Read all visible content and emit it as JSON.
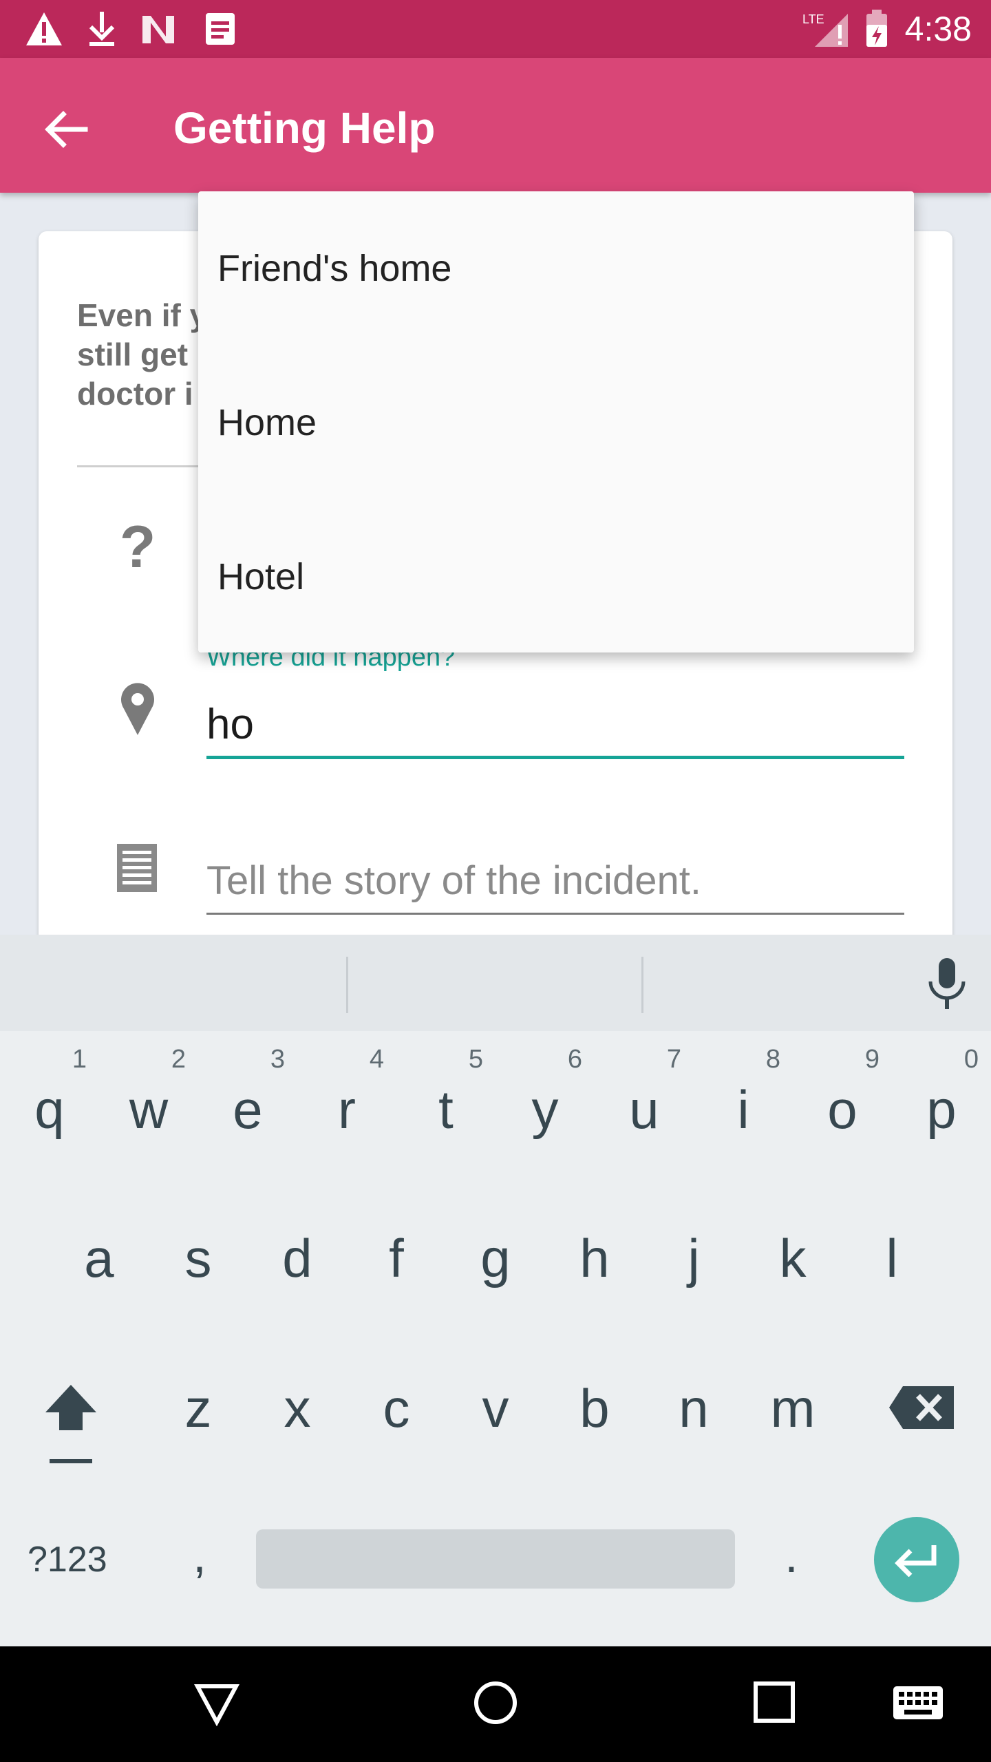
{
  "status_bar": {
    "time": "4:38",
    "network_label": "LTE",
    "left_icons": [
      "warning-icon",
      "download-icon",
      "n-logo-icon",
      "notes-icon"
    ],
    "right_icons": [
      "signal-icon",
      "battery-icon"
    ]
  },
  "app_bar": {
    "title": "Getting Help",
    "back_icon": "arrow-back-icon"
  },
  "card": {
    "intro_text": "Even if y\nstill get\ndoctor i",
    "question_icon": "?",
    "location_field": {
      "label": "Where did it happen?",
      "value": "ho"
    },
    "story_field": {
      "placeholder": "Tell the story of the incident."
    }
  },
  "dropdown": {
    "items": [
      "Friend's home",
      "Home",
      "Hotel"
    ]
  },
  "keyboard": {
    "row1": [
      {
        "key": "q",
        "hint": "1"
      },
      {
        "key": "w",
        "hint": "2"
      },
      {
        "key": "e",
        "hint": "3"
      },
      {
        "key": "r",
        "hint": "4"
      },
      {
        "key": "t",
        "hint": "5"
      },
      {
        "key": "y",
        "hint": "6"
      },
      {
        "key": "u",
        "hint": "7"
      },
      {
        "key": "i",
        "hint": "8"
      },
      {
        "key": "o",
        "hint": "9"
      },
      {
        "key": "p",
        "hint": "0"
      }
    ],
    "row2": [
      "a",
      "s",
      "d",
      "f",
      "g",
      "h",
      "j",
      "k",
      "l"
    ],
    "row3": [
      "z",
      "x",
      "c",
      "v",
      "b",
      "n",
      "m"
    ],
    "symbols_label": "?123",
    "comma": ",",
    "period": "."
  },
  "colors": {
    "status_bar": "#bb285a",
    "app_bar": "#d94677",
    "accent": "#16a496",
    "enter_key": "#4db6ac"
  }
}
